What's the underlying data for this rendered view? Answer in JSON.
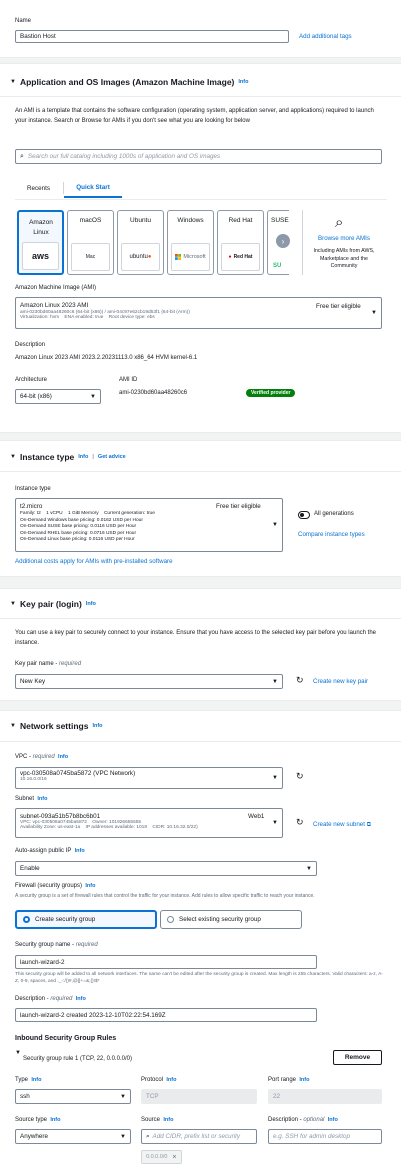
{
  "name_section": {
    "label": "Name",
    "value": "Bastion Host",
    "add_tags": "Add additional tags"
  },
  "ami_section": {
    "title": "Application and OS Images (Amazon Machine Image)",
    "info": "Info",
    "description": "An AMI is a template that contains the software configuration (operating system, application server, and applications) required to launch your instance. Search or Browse for AMIs if you don't see what you are looking for below",
    "search_placeholder": "Search our full catalog including 1000s of application and OS images",
    "tabs": [
      "Recents",
      "Quick Start"
    ],
    "os_tiles": [
      {
        "name": "Amazon Linux",
        "logo": "aws"
      },
      {
        "name": "macOS",
        "logo": "Mac"
      },
      {
        "name": "Ubuntu",
        "logo": "ubuntu"
      },
      {
        "name": "Windows",
        "logo": "Microsoft"
      },
      {
        "name": "Red Hat",
        "logo": "Red Hat"
      },
      {
        "name": "SUSE",
        "logo": "SU"
      }
    ],
    "browse_more": "Browse more AMIs",
    "browse_desc": "Including AMIs from AWS, Marketplace and the Community",
    "ami_label": "Amazon Machine Image (AMI)",
    "ami_name": "Amazon Linux 2023 AMI",
    "ami_ids": "ami-0230bd60aa48260c6 (64-bit (x86)) / ami-04c97e62cb19d53f1 (64-bit (Arm))",
    "ami_virt": "Virtualization: hvm    ENA enabled: true    Root device type: ebs",
    "free_tier": "Free tier eligible",
    "desc_label": "Description",
    "desc_value": "Amazon Linux 2023 AMI 2023.2.20231113.0 x86_64 HVM kernel-6.1",
    "arch_label": "Architecture",
    "arch_value": "64-bit (x86)",
    "ami_id_label": "AMI ID",
    "ami_id_value": "ami-0230bd60aa48260c6",
    "verified": "Verified provider"
  },
  "instance_section": {
    "title": "Instance type",
    "info": "Info",
    "advice": "Get advice",
    "label": "Instance type",
    "type_name": "t2.micro",
    "free_tier": "Free tier eligible",
    "line1": "Family: t2    1 vCPU    1 GiB Memory    Current generation: true",
    "line2": "On-Demand Windows base pricing: 0.0162 USD per Hour",
    "line3": "On-Demand SUSE base pricing: 0.0116 USD per Hour",
    "line4": "On-Demand RHEL base pricing: 0.0716 USD per Hour",
    "line5": "On-Demand Linux base pricing: 0.0116 USD per Hour",
    "all_generations": "All generations",
    "compare": "Compare instance types",
    "additional_costs": "Additional costs apply for AMIs with pre-installed software"
  },
  "keypair_section": {
    "title": "Key pair (login)",
    "info": "Info",
    "description": "You can use a key pair to securely connect to your instance. Ensure that you have access to the selected key pair before you launch the instance.",
    "label": "Key pair name",
    "required": "required",
    "value": "New Key",
    "create": "Create new key pair"
  },
  "network_section": {
    "title": "Network settings",
    "info": "Info",
    "vpc_label": "VPC",
    "required": "required",
    "vpc_value": "vpc-030508a0745ba5872 (VPC Network)",
    "vpc_cidr": "10.16.0.0/16",
    "subnet_label": "Subnet",
    "subnet_value": "subnet-093a51b57b8bc6b01",
    "subnet_name": "Web1",
    "subnet_line1": "VPC: vpc-030508a0745ba5872    Owner: 101926655555",
    "subnet_line2": "Availability Zone: us-east-1a    IP addresses available: 1018    CIDR: 10.16.32.0/22)",
    "create_subnet": "Create new subnet",
    "auto_ip_label": "Auto-assign public IP",
    "auto_ip_value": "Enable",
    "firewall_label": "Firewall (security groups)",
    "firewall_desc": "A security group is a set of firewall rules that control the traffic for your instance. Add rules to allow specific traffic to reach your instance.",
    "create_sg": "Create security group",
    "select_sg": "Select existing security group",
    "sg_name_label": "Security group name",
    "sg_name_value": "launch-wizard-2",
    "sg_name_hint": "This security group will be added to all network interfaces. The name can't be edited after the security group is created. Max length is 255 characters. Valid characters: a-z, A-Z, 0-9, spaces, and ._-:/()#,@[]+=&;{}!$*",
    "desc_label": "Description",
    "desc_value": "launch-wizard-2 created 2023-12-10T02:22:54.169Z",
    "inbound_title": "Inbound Security Group Rules",
    "rule_title": "Security group rule 1 (TCP, 22, 0.0.0.0/0)",
    "remove": "Remove",
    "type_label": "Type",
    "type_value": "ssh",
    "protocol_label": "Protocol",
    "protocol_value": "TCP",
    "port_label": "Port range",
    "port_value": "22",
    "source_type_label": "Source type",
    "source_type_value": "Anywhere",
    "source_label": "Source",
    "source_placeholder": "Add CIDR, prefix list or security",
    "source_token": "0.0.0.0/0",
    "rule_desc_label": "Description",
    "optional": "optional",
    "rule_desc_placeholder": "e.g. SSH for admin desktop"
  }
}
